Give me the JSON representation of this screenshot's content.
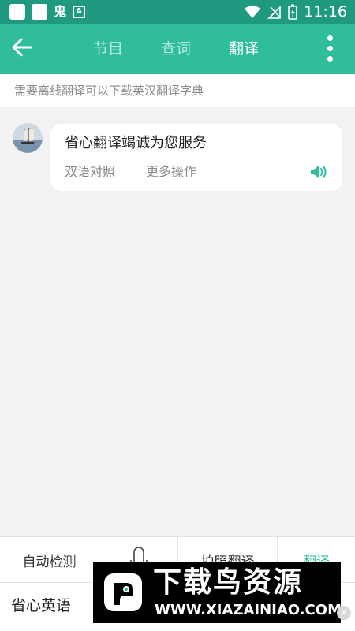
{
  "status_bar": {
    "time": "11:16",
    "notification_glyph": "鬼",
    "notification_badge": "A",
    "icons": [
      "app-square-icon",
      "app-square-icon",
      "ghost-icon",
      "a-badge-icon",
      "wifi-icon",
      "no-signal-icon",
      "battery-charging-icon"
    ]
  },
  "header": {
    "tabs": [
      {
        "label": "节目",
        "active": false
      },
      {
        "label": "查词",
        "active": false
      },
      {
        "label": "翻译",
        "active": true
      }
    ]
  },
  "notice": "需要离线翻译可以下载英汉翻译字典",
  "message": {
    "text": "省心翻译竭诚为您服务",
    "bilingual_link": "双语对照",
    "more_actions": "更多操作",
    "speaker_icon": "speaker-icon"
  },
  "toolbar": {
    "auto_detect": "自动检测",
    "photo_translate": "拍照翻译",
    "translate": "翻译",
    "mic_icon": "microphone-icon"
  },
  "brand": "省心英语",
  "watermark": {
    "title": "下载鸟资源",
    "url": "WWW.XIAZAINIAO.COM"
  },
  "colors": {
    "status_bar": "#1f9a80",
    "app_bar": "#2fbd9c",
    "accent": "#2fbd9c",
    "background": "#f2f2f2"
  }
}
